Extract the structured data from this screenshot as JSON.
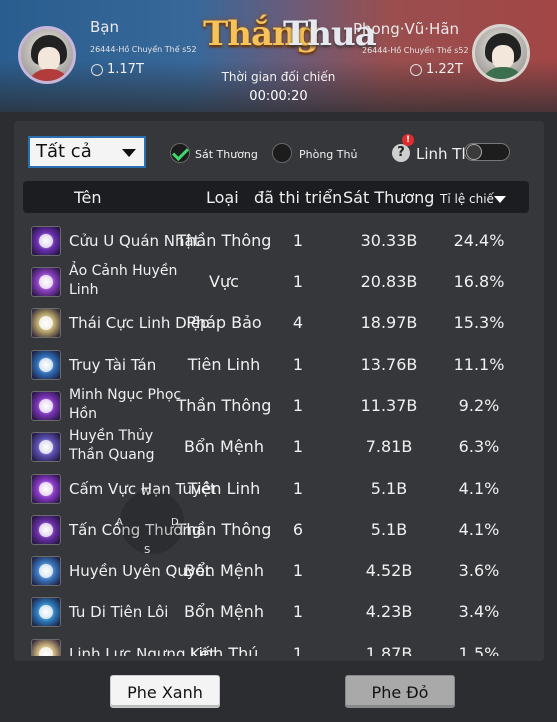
{
  "header": {
    "result_win": "Thắng",
    "result_lose": "Thua",
    "time_label": "Thời gian đối chiến",
    "timer": "00:00:20",
    "left_player": {
      "name": "Bạn",
      "server": "26444-Hồ Chuyển Thế s52",
      "power": "1.17T"
    },
    "right_player": {
      "name": "Phong·Vũ·Hãn",
      "server": "26444-Hồ Chuyển Thế s52",
      "power": "1.22T"
    }
  },
  "filters": {
    "dropdown_value": "Tất cả",
    "option_damage": "Sát Thương",
    "option_defense": "Phòng Thủ",
    "help_icon": "?",
    "alert_icon": "!",
    "toggle_label": "Linh Thú"
  },
  "table": {
    "headers": {
      "name": "Tên",
      "type": "Loại",
      "count": "đã thi triển",
      "damage": "Sát Thương",
      "ratio": "Tỉ lệ chiế"
    },
    "rows": [
      {
        "name": "Cửu U Quán Nhật",
        "type": "Thần Thông",
        "count": "1",
        "damage": "30.33B",
        "pct": "24.4%",
        "color": "#6a2fb0"
      },
      {
        "name": "Ảo Cảnh Huyền Linh",
        "type": "Vực",
        "count": "1",
        "damage": "20.83B",
        "pct": "16.8%",
        "color": "#8a3fc0"
      },
      {
        "name": "Thái Cực Linh Diệp",
        "type": "Pháp Bảo",
        "count": "4",
        "damage": "18.97B",
        "pct": "15.3%",
        "color": "#b8a66a"
      },
      {
        "name": "Truy Tài Tán",
        "type": "Tiên Linh",
        "count": "1",
        "damage": "13.76B",
        "pct": "11.1%",
        "color": "#2f6fb8"
      },
      {
        "name": "Minh Ngục Phọc Hồn",
        "type": "Thần Thông",
        "count": "1",
        "damage": "11.37B",
        "pct": "9.2%",
        "color": "#7a34b8"
      },
      {
        "name": "Huyền Thủy Thần Quang",
        "type": "Bổn Mệnh",
        "count": "1",
        "damage": "7.81B",
        "pct": "6.3%",
        "color": "#5a4fb0"
      },
      {
        "name": "Cấm Vực Hạn Tuyệt",
        "type": "Tiên Linh",
        "count": "1",
        "damage": "5.1B",
        "pct": "4.1%",
        "color": "#8a3ac8"
      },
      {
        "name": "Tấn Công Thường",
        "type": "Thần Thông",
        "count": "6",
        "damage": "5.1B",
        "pct": "4.1%",
        "color": "#6a2fa8"
      },
      {
        "name": "Huyền Uyên Quyết",
        "type": "Bổn Mệnh",
        "count": "1",
        "damage": "4.52B",
        "pct": "3.6%",
        "color": "#3a78c0"
      },
      {
        "name": "Tu Di Tiên Lôi",
        "type": "Bổn Mệnh",
        "count": "1",
        "damage": "4.23B",
        "pct": "3.4%",
        "color": "#2d7fbf"
      },
      {
        "name": "Linh Lực Ngưng Kết",
        "type": "Linh Thú",
        "count": "1",
        "damage": "1.87B",
        "pct": "1.5%",
        "color": "#c8b07a"
      }
    ]
  },
  "joystick": {
    "w": "W",
    "a": "A",
    "d": "D",
    "s": "S"
  },
  "buttons": {
    "blue_team": "Phe Xanh",
    "red_team": "Phe Đỏ"
  }
}
